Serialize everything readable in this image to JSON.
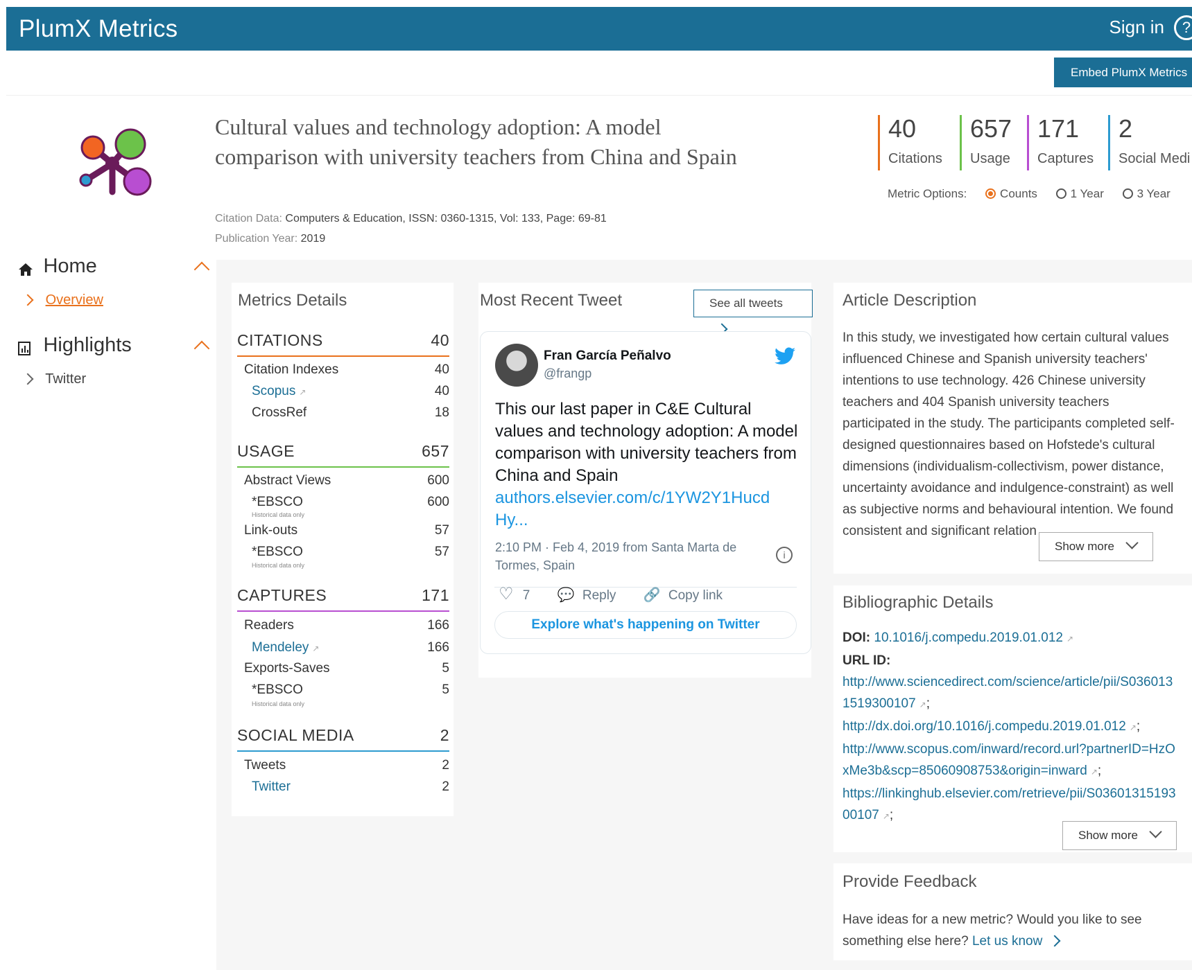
{
  "header": {
    "brand": "PlumX Metrics",
    "signin": "Sign in",
    "help_glyph": "?",
    "embed_button": "Embed PlumX Metrics"
  },
  "article": {
    "title": "Cultural values and technology adoption: A model comparison with university teachers from China and Spain",
    "citation_label": "Citation Data:",
    "citation_value": "Computers & Education, ISSN: 0360-1315, Vol: 133, Page: 69-81",
    "year_label": "Publication Year:",
    "year_value": "2019"
  },
  "top_metrics": [
    {
      "value": "40",
      "label": "Citations",
      "color": "#e9711c"
    },
    {
      "value": "657",
      "label": "Usage",
      "color": "#6cc24a"
    },
    {
      "value": "171",
      "label": "Captures",
      "color": "#b84ed1"
    },
    {
      "value": "2",
      "label": "Social Medi",
      "color": "#2d9bd0"
    }
  ],
  "metric_options": {
    "label": "Metric Options:",
    "options": [
      "Counts",
      "1 Year",
      "3 Year"
    ],
    "selected": "Counts"
  },
  "nav": {
    "home": "Home",
    "overview": "Overview",
    "highlights": "Highlights",
    "twitter": "Twitter"
  },
  "metrics_details": {
    "title": "Metrics Details",
    "citations": {
      "label": "CITATIONS",
      "value": "40",
      "color": "#e9711c",
      "rows": [
        [
          "Citation Indexes",
          "40"
        ],
        [
          "Scopus",
          "40"
        ],
        [
          "CrossRef",
          "18"
        ]
      ]
    },
    "usage": {
      "label": "USAGE",
      "value": "657",
      "color": "#6cc24a",
      "rows": [
        [
          "Abstract Views",
          "600"
        ],
        [
          "*EBSCO",
          "600"
        ],
        [
          "Link-outs",
          "57"
        ],
        [
          "*EBSCO",
          "57"
        ]
      ]
    },
    "captures": {
      "label": "CAPTURES",
      "value": "171",
      "color": "#b84ed1",
      "rows": [
        [
          "Readers",
          "166"
        ],
        [
          "Mendeley",
          "166"
        ],
        [
          "Exports-Saves",
          "5"
        ],
        [
          "*EBSCO",
          "5"
        ]
      ]
    },
    "social": {
      "label": "SOCIAL MEDIA",
      "value": "2",
      "color": "#2d9bd0",
      "rows": [
        [
          "Tweets",
          "2"
        ],
        [
          "Twitter",
          "2"
        ]
      ]
    },
    "historical_note": "Historical data only"
  },
  "tweet_section": {
    "title": "Most Recent Tweet",
    "see_all": "See all tweets",
    "author": "Fran García Peñalvo",
    "handle": "@frangp",
    "text": "This our last paper in C&E Cultural values and technology adoption: A model comparison with university teachers from China and Spain",
    "link": "authors.elsevier.com/c/1YW2Y1Hucd Hy...",
    "meta": "2:10 PM · Feb 4, 2019 from Santa Marta de Tormes, Spain",
    "likes": "7",
    "reply": "Reply",
    "copy_link": "Copy link",
    "explore": "Explore what's happening on Twitter"
  },
  "description": {
    "title": "Article Description",
    "text": "In this study, we investigated how certain cultural values influenced Chinese and Spanish university teachers' intentions to use technology. 426 Chinese university teachers and 404 Spanish university teachers participated in the study. The participants completed self-designed questionnaires based on Hofstede's cultural dimensions (individualism-collectivism, power distance, uncertainty avoidance and indulgence-constraint) as well as subjective norms and behavioural intention. We found consistent and significant relation",
    "show_more": "Show more"
  },
  "biblio": {
    "title": "Bibliographic Details",
    "doi_label": "DOI:",
    "doi": "10.1016/j.compedu.2019.01.012",
    "url_label": "URL ID:",
    "urls": [
      "http://www.sciencedirect.com/science/article/pii/S0360131519300107",
      "http://dx.doi.org/10.1016/j.compedu.2019.01.012",
      "http://www.scopus.com/inward/record.url?partnerID=HzOxMe3b&scp=85060908753&origin=inward",
      "https://linkinghub.elsevier.com/retrieve/pii/S0360131519300107"
    ],
    "show_more": "Show more"
  },
  "feedback": {
    "title": "Provide Feedback",
    "text": "Have ideas for a new metric? Would you like to see something else here?",
    "link": "Let us know"
  }
}
